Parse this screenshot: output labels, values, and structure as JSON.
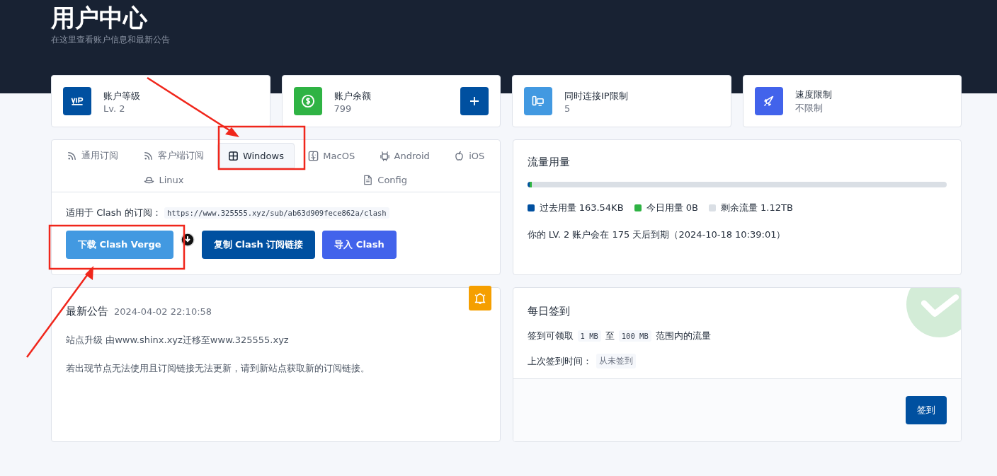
{
  "header": {
    "title": "用户中心",
    "subtitle": "在这里查看账户信息和最新公告"
  },
  "stats": [
    {
      "kind": "vip",
      "label": "账户等级",
      "value": "Lv. 2",
      "color": "#0050a0",
      "has_add": false
    },
    {
      "kind": "money",
      "label": "账户余额",
      "value": "799",
      "color": "#2fb344",
      "has_add": true
    },
    {
      "kind": "devices",
      "label": "同时连接IP限制",
      "value": "5",
      "color": "#4299e1",
      "has_add": false
    },
    {
      "kind": "rocket",
      "label": "速度限制",
      "value": "不限制",
      "color": "#4263eb",
      "has_add": false
    }
  ],
  "subscription": {
    "tabs": [
      {
        "label": "通用订阅",
        "kind": "rss",
        "selected": false
      },
      {
        "label": "客户端订阅",
        "kind": "rss",
        "selected": false
      },
      {
        "label": "Windows",
        "kind": "windows",
        "selected": true
      },
      {
        "label": "MacOS",
        "kind": "mac",
        "selected": false
      },
      {
        "label": "Android",
        "kind": "android",
        "selected": false
      },
      {
        "label": "iOS",
        "kind": "apple",
        "selected": false
      },
      {
        "label": "Linux",
        "kind": "linux",
        "selected": false
      },
      {
        "label": "Config",
        "kind": "file",
        "selected": false
      }
    ],
    "url_label": "适用于 Clash 的订阅：",
    "url": "https://www.325555.xyz/sub/ab63d909fece862a/clash",
    "buttons": [
      {
        "label": "下载 Clash Verge",
        "color": "#4299e1"
      },
      {
        "label": "复制 Clash 订阅链接",
        "color": "#0050a0"
      },
      {
        "label": "导入 Clash",
        "color": "#4263eb"
      }
    ]
  },
  "traffic": {
    "title": "流量用量",
    "segments": [
      {
        "label": "过去用量 163.54KB",
        "color": "#0050a0",
        "level": 0.004
      },
      {
        "label": "今日用量 0B",
        "color": "#2fb344",
        "level": 0.006
      }
    ],
    "remaining": {
      "label": "剩余流量 1.12TB",
      "color": "#dadfe5"
    },
    "expiry": "你的 LV. 2 账户会在 175 天后到期（2024-10-18 10:39:01）"
  },
  "announcement": {
    "title": "最新公告",
    "date": "2024-04-02 22:10:58",
    "paragraphs": [
      "站点升级 由www.shinx.xyz迁移至www.325555.xyz",
      "若出现节点无法使用且订阅链接无法更新，请到新站点获取新的订阅链接。"
    ]
  },
  "checkin": {
    "title": "每日签到",
    "prefix": "签到可领取",
    "min": "1 MB",
    "between": "至",
    "max": "100 MB",
    "suffix": "范围内的流量",
    "last_label": "上次签到时间：",
    "last_value": "从未签到",
    "button": "签到"
  }
}
